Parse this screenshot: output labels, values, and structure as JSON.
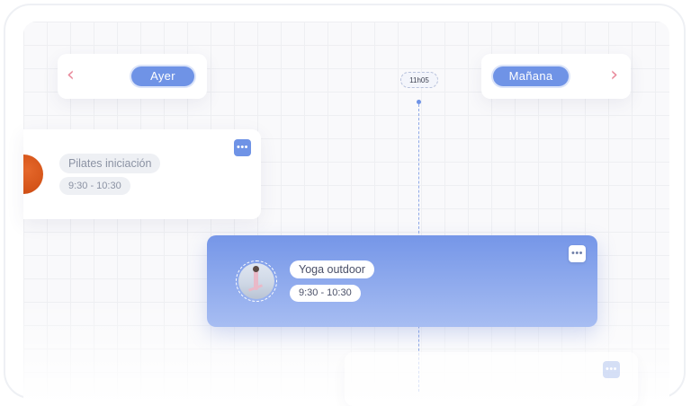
{
  "day_nav": {
    "previous_label": "Ayer",
    "next_label": "Mañana",
    "previous_chevron": "‹",
    "next_chevron": "›"
  },
  "current_time": "11h05",
  "classes": [
    {
      "title": "Pilates iniciación",
      "time": "9:30 - 10:30",
      "more": "•••",
      "style": "white"
    },
    {
      "title": "Yoga outdoor",
      "time": "9:30 - 10:30",
      "more": "•••",
      "style": "blue"
    },
    {
      "title": "",
      "time": "",
      "more": "•••",
      "style": "ghost"
    }
  ],
  "colors": {
    "accent": "#6f93e6",
    "chevron": "#e98a9b",
    "card_blue_top": "#7596e8",
    "card_blue_bottom": "#a7bdf2"
  },
  "icons": {
    "prev": "chevron-left-icon",
    "next": "chevron-right-icon",
    "more": "more-horizontal-icon"
  }
}
